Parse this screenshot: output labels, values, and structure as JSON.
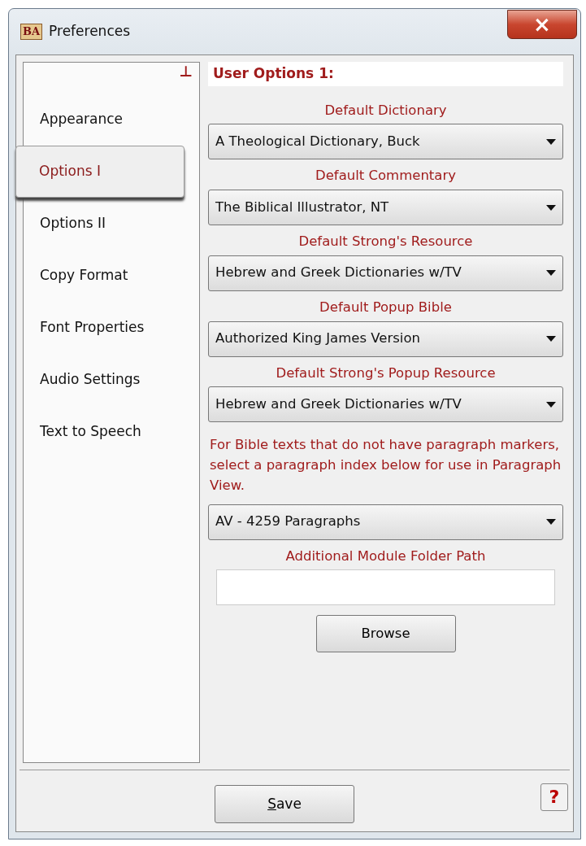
{
  "window": {
    "title": "Preferences",
    "app_badge": "BA",
    "close": "×"
  },
  "sidebar": {
    "pin": "⊥",
    "items": [
      {
        "label": "Appearance",
        "selected": false
      },
      {
        "label": "Options I",
        "selected": true
      },
      {
        "label": "Options II",
        "selected": false
      },
      {
        "label": "Copy Format",
        "selected": false
      },
      {
        "label": "Font Properties",
        "selected": false
      },
      {
        "label": "Audio Settings",
        "selected": false
      },
      {
        "label": "Text to Speech",
        "selected": false
      }
    ]
  },
  "panel": {
    "heading": "User Options 1:",
    "fields": [
      {
        "kind": "dropdown",
        "label": "Default Dictionary",
        "value": "A Theological Dictionary, Buck"
      },
      {
        "kind": "dropdown",
        "label": "Default Commentary",
        "value": "The Biblical Illustrator, NT"
      },
      {
        "kind": "dropdown",
        "label": "Default Strong's Resource",
        "value": "Hebrew and Greek Dictionaries w/TV"
      },
      {
        "kind": "dropdown",
        "label": "Default Popup Bible",
        "value": "Authorized King James Version"
      },
      {
        "kind": "dropdown",
        "label": "Default Strong's Popup Resource",
        "value": "Hebrew and Greek Dictionaries w/TV"
      },
      {
        "kind": "dropdown",
        "note": "For Bible texts that do not have paragraph markers, select a paragraph index below for use in Paragraph View.",
        "value": "AV - 4259 Paragraphs"
      },
      {
        "kind": "text",
        "label": "Additional Module Folder Path"
      }
    ],
    "browse_button": "Browse"
  },
  "footer": {
    "save_button": {
      "label": "Save",
      "access_key_underlined": true
    },
    "help_button": "?"
  }
}
